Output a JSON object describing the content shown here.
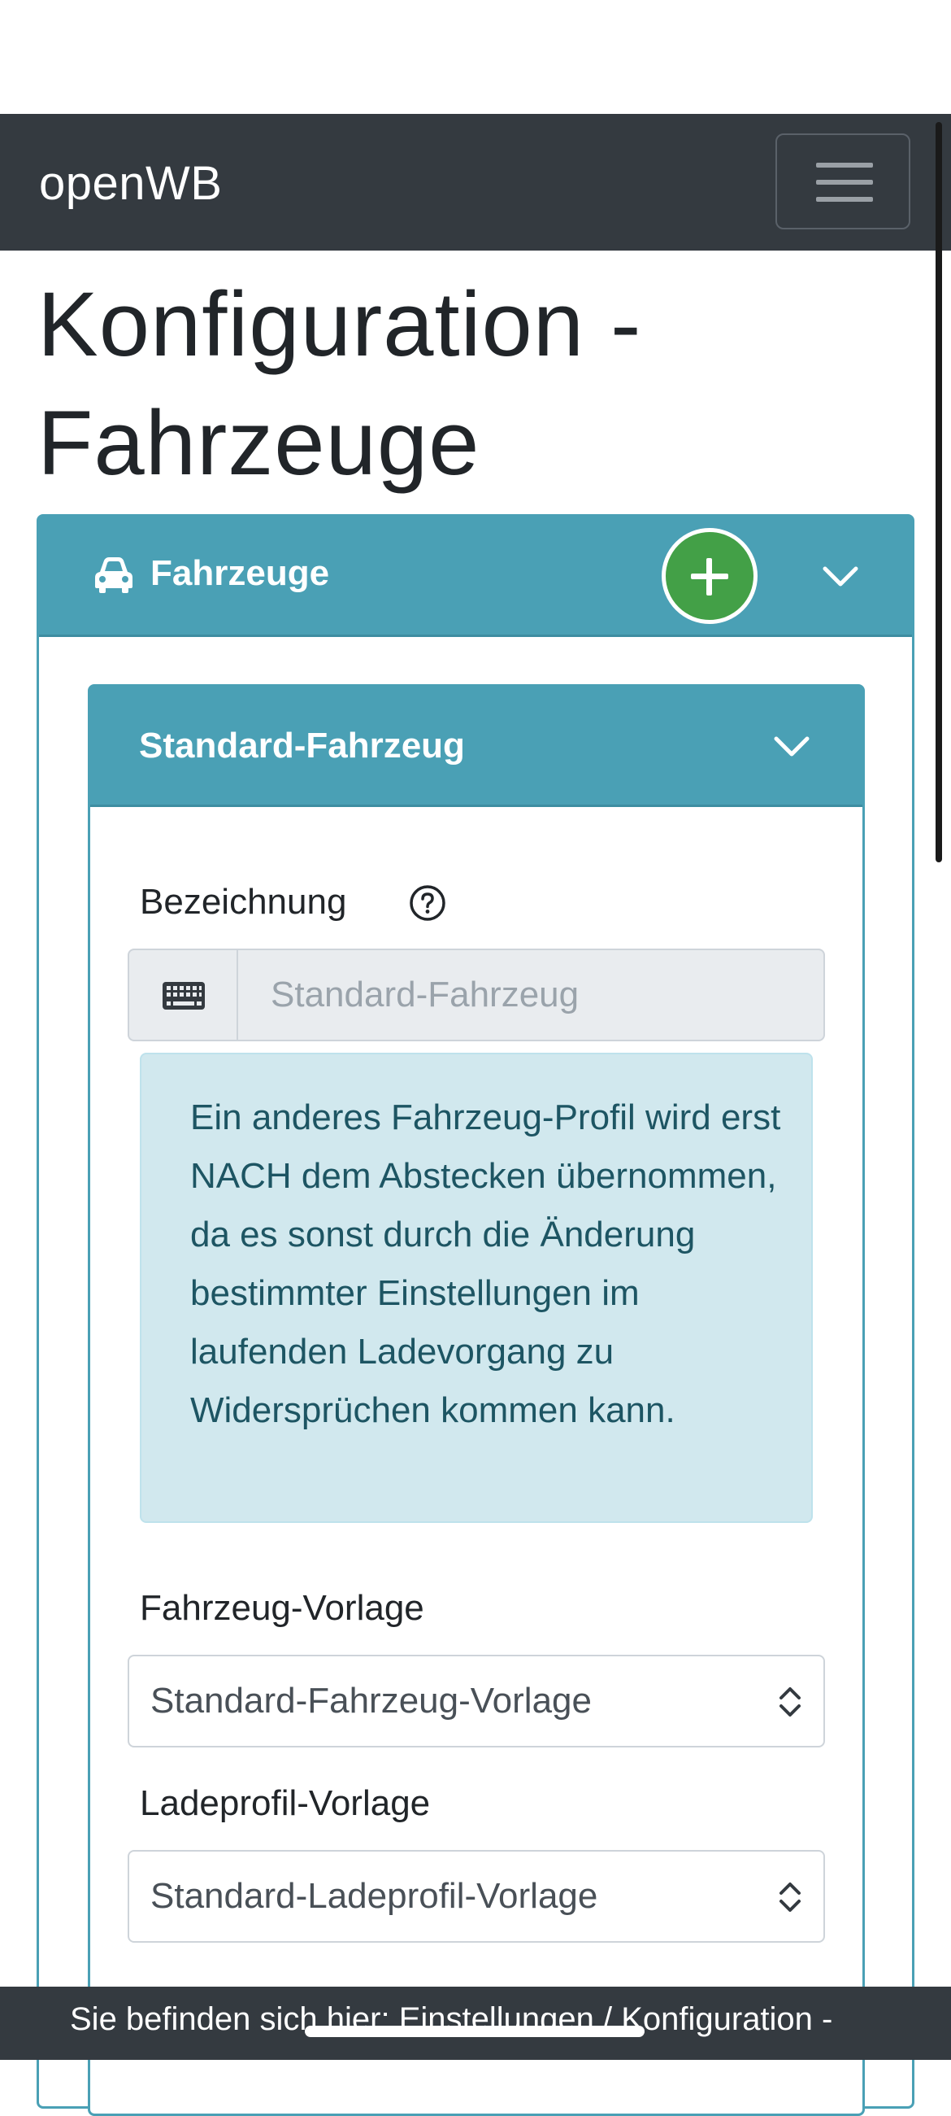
{
  "navbar": {
    "brand": "openWB",
    "menu_icon": "hamburger-menu-icon"
  },
  "page": {
    "title": "Konfiguration - Fahrzeuge"
  },
  "vehicles_card": {
    "title": "Fahrzeuge",
    "icon": "car-icon",
    "add_icon": "plus-icon",
    "collapse_icon": "chevron-down-icon",
    "accent_color": "#4aa0b5",
    "add_color": "#43a047"
  },
  "vehicle": {
    "title": "Standard-Fahrzeug",
    "collapse_icon": "chevron-down-icon",
    "name_label": "Bezeichnung",
    "name_help_icon": "question-circle-icon",
    "name_input_icon": "keyboard-icon",
    "name_value": "Standard-Fahrzeug",
    "info_text": "Ein anderes Fahrzeug-Profil wird erst NACH dem Abstecken übernommen, da es sonst durch die Änderung bestimmter Einstellungen im laufenden Ladevorgang zu Widersprüchen kommen kann.",
    "vehicle_template_label": "Fahrzeug-Vorlage",
    "vehicle_template_value": "Standard-Fahrzeug-Vorlage",
    "charge_template_label": "Ladeprofil-Vorlage",
    "charge_template_value": "Standard-Ladeprofil-Vorlage"
  },
  "footer": {
    "breadcrumb_text": "Sie befinden sich hier: Einstellungen / Konfiguration -"
  }
}
